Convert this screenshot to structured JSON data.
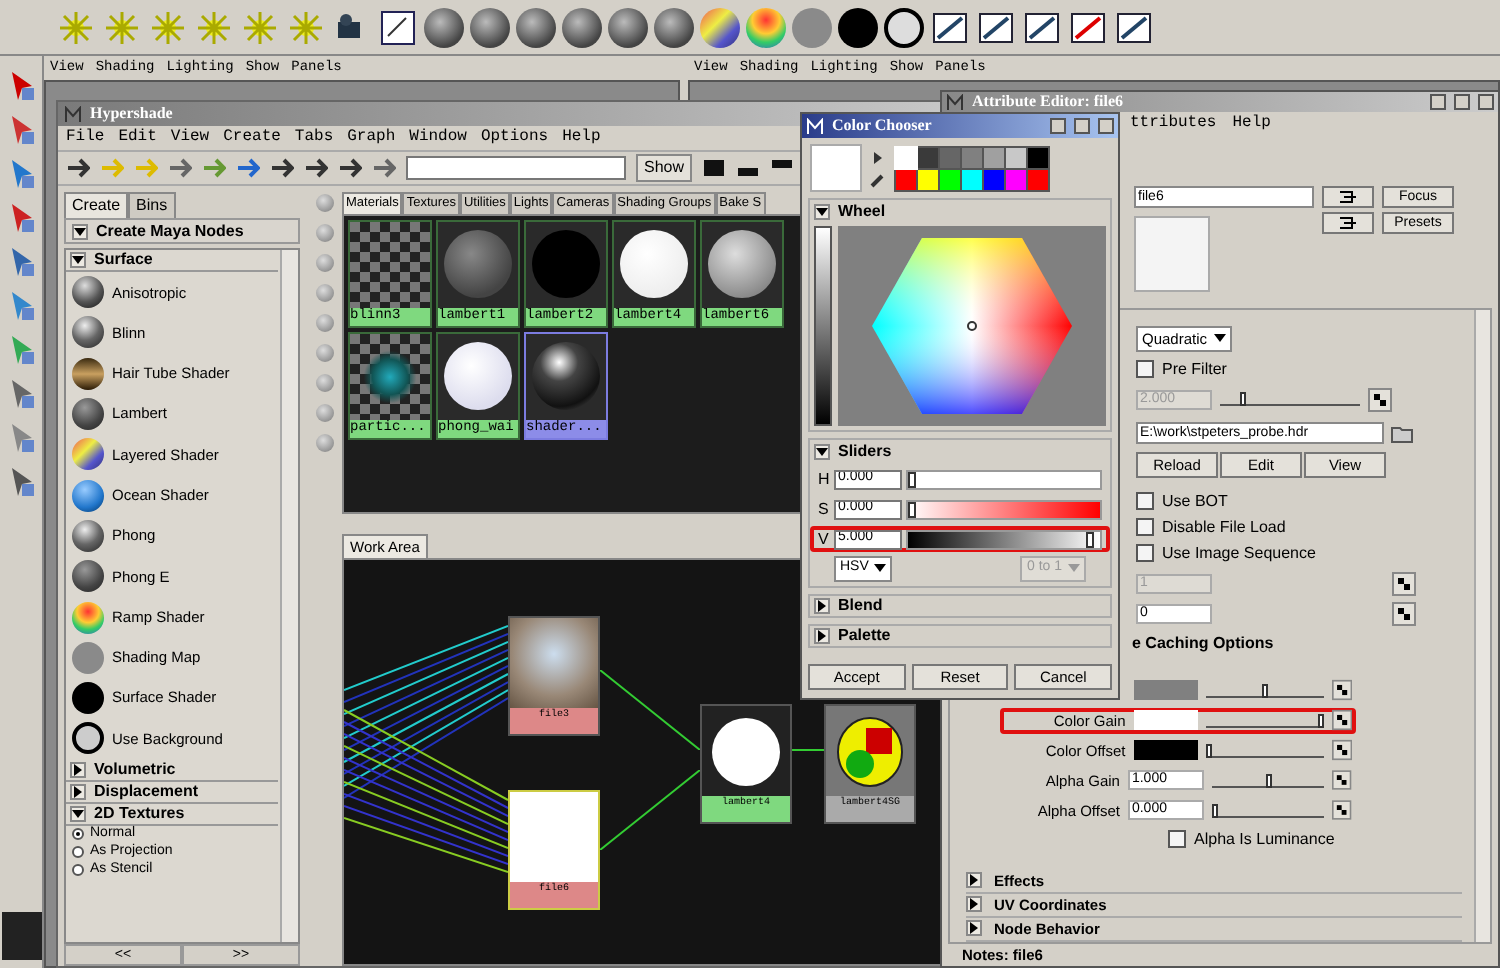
{
  "viewports": [
    {
      "menu": [
        "View",
        "Shading",
        "Lighting",
        "Show",
        "Panels"
      ]
    },
    {
      "menu": [
        "View",
        "Shading",
        "Lighting",
        "Show",
        "Panels"
      ]
    }
  ],
  "hypershade": {
    "title": "Hypershade",
    "menu": [
      "File",
      "Edit",
      "View",
      "Create",
      "Tabs",
      "Graph",
      "Window",
      "Options",
      "Help"
    ],
    "show_button": "Show",
    "side_tabs": [
      {
        "label": "Create",
        "selected": true
      },
      {
        "label": "Bins",
        "selected": false
      }
    ],
    "create_header": "Create Maya Nodes",
    "sections": [
      {
        "label": "Surface",
        "expanded": true,
        "items": [
          {
            "label": "Anisotropic",
            "kind": "aniso"
          },
          {
            "label": "Blinn",
            "kind": "blinn"
          },
          {
            "label": "Hair Tube Shader",
            "kind": "hair"
          },
          {
            "label": "Lambert",
            "kind": "lambert"
          },
          {
            "label": "Layered Shader",
            "kind": "layered"
          },
          {
            "label": "Ocean Shader",
            "kind": "ocean"
          },
          {
            "label": "Phong",
            "kind": "blinn"
          },
          {
            "label": "Phong E",
            "kind": "lambert"
          },
          {
            "label": "Ramp Shader",
            "kind": "ramp"
          },
          {
            "label": "Shading Map",
            "kind": "flat"
          },
          {
            "label": "Surface Shader",
            "kind": "black"
          },
          {
            "label": "Use Background",
            "kind": "ring"
          }
        ]
      },
      {
        "label": "Volumetric",
        "expanded": false
      },
      {
        "label": "Displacement",
        "expanded": false
      },
      {
        "label": "2D Textures",
        "expanded": true,
        "options": [
          {
            "label": "Normal",
            "selected": true
          },
          {
            "label": "As Projection",
            "selected": false
          },
          {
            "label": "As Stencil",
            "selected": false
          }
        ]
      }
    ],
    "nav": [
      "<<",
      ">>"
    ],
    "tabs": [
      {
        "label": "Materials",
        "selected": true
      },
      {
        "label": "Textures",
        "selected": false
      },
      {
        "label": "Utilities",
        "selected": false
      },
      {
        "label": "Lights",
        "selected": false
      },
      {
        "label": "Cameras",
        "selected": false
      },
      {
        "label": "Shading Groups",
        "selected": false
      },
      {
        "label": "Bake S",
        "selected": false
      }
    ],
    "materials": [
      {
        "name": "blinn3",
        "kind": "checker",
        "selected": false
      },
      {
        "name": "lambert1",
        "kind": "grey",
        "selected": false
      },
      {
        "name": "lambert2",
        "kind": "black",
        "selected": false
      },
      {
        "name": "lambert4",
        "kind": "white",
        "selected": false
      },
      {
        "name": "lambert6",
        "kind": "light",
        "selected": false
      },
      {
        "name": "partic...",
        "kind": "particle",
        "selected": false
      },
      {
        "name": "phong_wai",
        "kind": "porcelain",
        "selected": false
      },
      {
        "name": "shader...",
        "kind": "shiny",
        "selected": true
      }
    ],
    "work_area": {
      "tab": "Work Area",
      "nodes": [
        {
          "label": "file3",
          "kind": "photo"
        },
        {
          "label": "file6",
          "kind": "white"
        },
        {
          "label": "lambert4",
          "kind": "sphere"
        },
        {
          "label": "lambert4SG",
          "kind": "group"
        }
      ]
    }
  },
  "color_chooser": {
    "title": "Color Chooser",
    "palette": [
      {
        "color": "#ffffff",
        "selected": true
      },
      {
        "color": "#3a3a3a",
        "selected": false
      },
      {
        "color": "#666666",
        "selected": false
      },
      {
        "color": "#808080",
        "selected": false
      },
      {
        "color": "#a0a0a0",
        "selected": false
      },
      {
        "color": "#c8c8c8",
        "selected": false
      },
      {
        "color": "#000000",
        "selected": false
      },
      {
        "color": "#ff0000",
        "selected": false
      },
      {
        "color": "#ffff00",
        "selected": false
      },
      {
        "color": "#00ff00",
        "selected": false
      },
      {
        "color": "#00ffff",
        "selected": false
      },
      {
        "color": "#0000ff",
        "selected": false
      },
      {
        "color": "#ff00ff",
        "selected": false
      },
      {
        "color": "#ff0000",
        "selected": false
      }
    ],
    "wheel_label": "Wheel",
    "sliders_label": "Sliders",
    "sliders": [
      {
        "label": "H",
        "value": "0.000",
        "kind": "hue",
        "level": 0,
        "highlighted": false
      },
      {
        "label": "S",
        "value": "0.000",
        "kind": "sat",
        "level": 0,
        "highlighted": false
      },
      {
        "label": "V",
        "value": "5.000",
        "kind": "val",
        "level": 0.97,
        "highlighted": true
      }
    ],
    "mode": "HSV",
    "range": {
      "value": "0 to 1",
      "disabled": true
    },
    "collapsed": [
      "Blend",
      "Palette"
    ],
    "buttons": [
      "Accept",
      "Reset",
      "Cancel"
    ]
  },
  "attribute_editor": {
    "title": "Attribute Editor: file6",
    "menu": [
      "ttributes",
      "Help"
    ],
    "name": "file6",
    "buttons": [
      "Focus",
      "Presets"
    ],
    "filter": "Quadratic",
    "pre_filter": {
      "label": "Pre Filter",
      "checked": false
    },
    "filter_width": {
      "value": "2.000",
      "disabled": true,
      "level": 0.15
    },
    "path": "E:\\work\\stpeters_probe.hdr",
    "file_buttons": [
      "Reload",
      "Edit",
      "View"
    ],
    "checks": [
      {
        "label": "Use BOT",
        "checked": false
      },
      {
        "label": "Disable File Load",
        "checked": false
      },
      {
        "label": "Use Image Sequence",
        "checked": false
      }
    ],
    "frame_fields": [
      {
        "value": "1",
        "disabled": true
      },
      {
        "value": "0",
        "disabled": false
      }
    ],
    "caching": "e Caching Options",
    "balance": [
      {
        "kind": "swatch",
        "color": "#808080",
        "level": 0.5,
        "highlighted": false
      },
      {
        "label": "Color Gain",
        "kind": "swatch",
        "color": "#ffffff",
        "level": 1,
        "highlighted": true
      },
      {
        "label": "Color Offset",
        "kind": "swatch",
        "color": "#000000",
        "level": 0,
        "highlighted": false
      },
      {
        "label": "Alpha Gain",
        "kind": "number",
        "value": "1.000",
        "level": 0.5,
        "highlighted": false
      },
      {
        "label": "Alpha Offset",
        "kind": "number",
        "value": "0.000",
        "level": 0,
        "highlighted": false
      }
    ],
    "alpha_lum": {
      "label": "Alpha Is Luminance",
      "checked": false
    },
    "sections": [
      "Effects",
      "UV Coordinates",
      "Node Behavior"
    ],
    "notes": "Notes:  file6"
  }
}
